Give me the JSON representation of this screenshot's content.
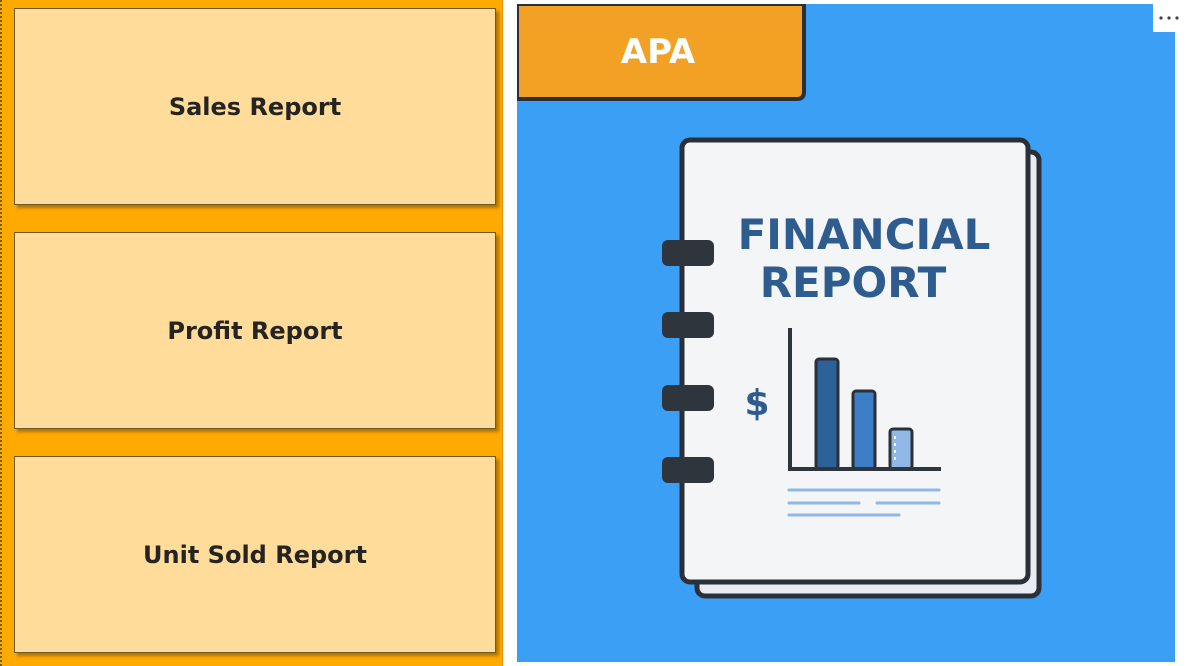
{
  "nav": {
    "sales_label": "Sales Report",
    "profit_label": "Profit Report",
    "units_label": "Unit Sold Report"
  },
  "image": {
    "tag_label": "APA",
    "title_line1": "FINANCIAL",
    "title_line2": "REPORT",
    "currency_symbol": "$"
  },
  "colors": {
    "nav_background": "#ffaa00",
    "button_fill": "#ffdc9a",
    "image_background": "#3ba0f5",
    "tag_fill": "#f2a124",
    "title_text": "#2e5c8f"
  },
  "icons": {
    "more": "more-options-icon"
  }
}
